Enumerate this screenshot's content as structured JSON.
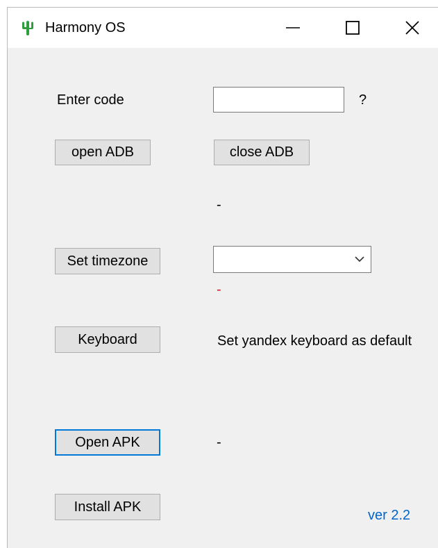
{
  "window": {
    "title": "Harmony OS",
    "icon": "cactus-icon",
    "controls": {
      "minimize": "minimize-icon",
      "maximize": "maximize-icon",
      "close": "close-icon"
    }
  },
  "code": {
    "label": "Enter code",
    "value": "",
    "help": "?"
  },
  "adb": {
    "open_label": "open ADB",
    "close_label": "close ADB",
    "status": "-"
  },
  "timezone": {
    "button_label": "Set timezone",
    "selected": "",
    "status": "-",
    "status_color": "#e81123"
  },
  "keyboard": {
    "button_label": "Keyboard",
    "description": "Set yandex keyboard as default"
  },
  "apk": {
    "open_label": "Open APK",
    "status": "-",
    "install_label": "Install APK"
  },
  "footer": {
    "version": "ver 2.2",
    "version_color": "#0066cc"
  },
  "colors": {
    "window_bg": "#f0f0f0",
    "button_bg": "#e1e1e1",
    "focus_border": "#0078d7",
    "icon_green": "#2e9e3e"
  }
}
